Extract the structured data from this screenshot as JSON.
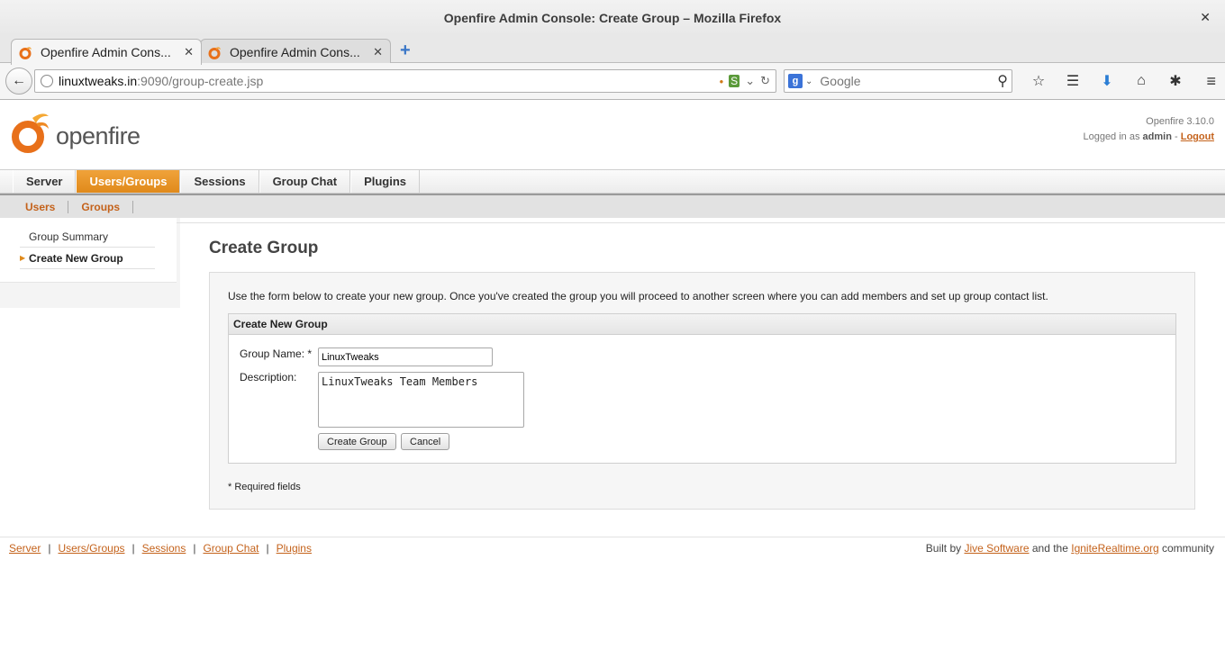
{
  "window": {
    "title": "Openfire Admin Console: Create Group – Mozilla Firefox",
    "close_glyph": "✕"
  },
  "tabs": [
    {
      "label": "Openfire Admin Cons...",
      "active": true
    },
    {
      "label": "Openfire Admin Cons...",
      "active": false
    }
  ],
  "tab_close_glyph": "✕",
  "new_tab_glyph": "+",
  "address": {
    "host": "linuxtweaks.in",
    "path": ":9090/group-create.jsp"
  },
  "search": {
    "placeholder": "Google",
    "engine_letter": "g"
  },
  "icons": {
    "back": "back-arrow-icon",
    "bookmark": "star-icon",
    "reading_list": "reading-list-icon",
    "download": "download-arrow-icon",
    "home": "home-icon",
    "addon": "addon-icon",
    "menu": "hamburger-menu-icon"
  },
  "glyphs": {
    "back": "←",
    "star": "☆",
    "list": "☰",
    "download": "⬇",
    "home": "⌂",
    "addon": "✱",
    "menu": "≡",
    "search": "⚲",
    "reload": "↻",
    "dropdown": "⌄",
    "arrow_right": "▶"
  },
  "openfire": {
    "logo_text": "openfire",
    "version": "Openfire 3.10.0",
    "logged_in_prefix": "Logged in as",
    "user": "admin",
    "separator": "-",
    "logout": "Logout",
    "brand_color": "#e08a1b",
    "link_color": "#c4621b"
  },
  "main_nav": [
    {
      "label": "Server",
      "active": false
    },
    {
      "label": "Users/Groups",
      "active": true
    },
    {
      "label": "Sessions",
      "active": false
    },
    {
      "label": "Group Chat",
      "active": false
    },
    {
      "label": "Plugins",
      "active": false
    }
  ],
  "sub_nav": [
    {
      "label": "Users"
    },
    {
      "label": "Groups",
      "active": true
    }
  ],
  "sidebar": [
    {
      "label": "Group Summary",
      "active": false
    },
    {
      "label": "Create New Group",
      "active": true
    }
  ],
  "page": {
    "title": "Create Group",
    "intro": "Use the form below to create your new group. Once you've created the group you will proceed to another screen where you can add members and set up group contact list.",
    "form_title": "Create New Group",
    "group_name_label": "Group Name: *",
    "group_name_value": "LinuxTweaks",
    "description_label": "Description:",
    "description_value": "LinuxTweaks Team Members",
    "create_button": "Create Group",
    "cancel_button": "Cancel",
    "required_note": "* Required fields"
  },
  "footer": {
    "links": [
      "Server",
      "Users/Groups",
      "Sessions",
      "Group Chat",
      "Plugins"
    ],
    "link_separator": "|",
    "credit_prefix": "Built by",
    "credit_link1": "Jive Software",
    "credit_middle": "and the",
    "credit_link2": "IgniteRealtime.org",
    "credit_suffix": "community"
  }
}
